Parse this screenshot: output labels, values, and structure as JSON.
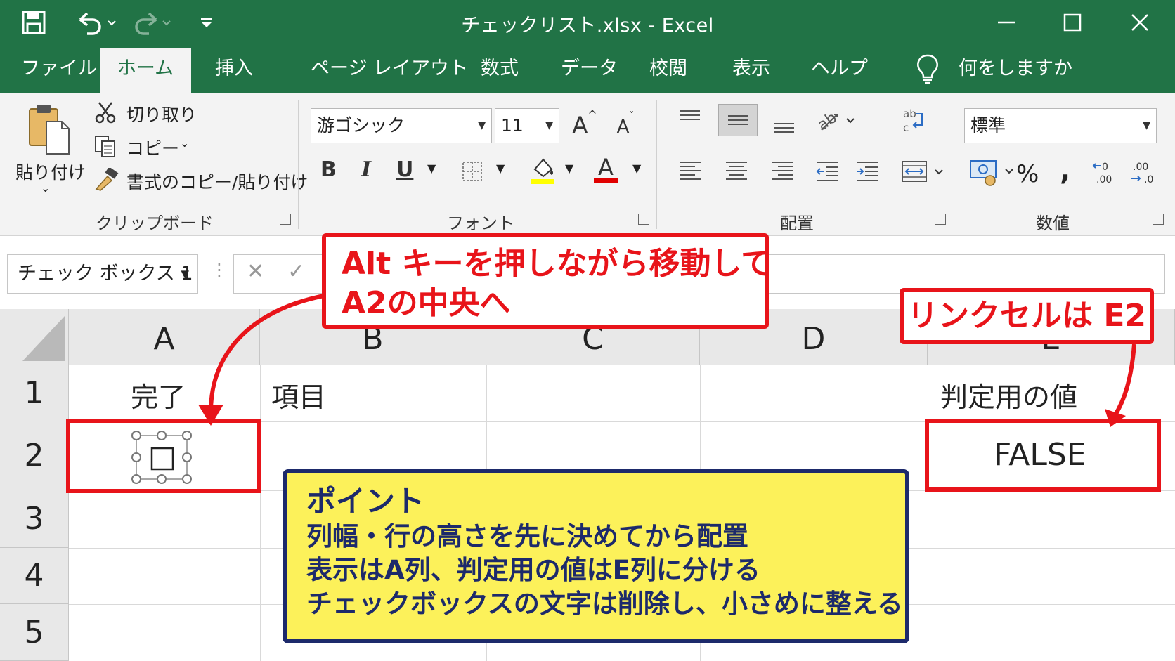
{
  "window": {
    "title": "チェックリスト.xlsx  -  Excel",
    "minimize_icon": "minimize-icon",
    "maximize_icon": "maximize-icon",
    "close_icon": "close-icon"
  },
  "tabs": [
    {
      "label": "ファイル",
      "active": false
    },
    {
      "label": "ホーム",
      "active": true
    },
    {
      "label": "挿入",
      "active": false
    },
    {
      "label": "ページ レイアウト",
      "active": false
    },
    {
      "label": "数式",
      "active": false
    },
    {
      "label": "データ",
      "active": false
    },
    {
      "label": "校閲",
      "active": false
    },
    {
      "label": "表示",
      "active": false
    },
    {
      "label": "ヘルプ",
      "active": false
    }
  ],
  "tell_me": "何をしますか",
  "ribbon": {
    "clipboard": {
      "paste_label": "貼り付け",
      "cut_label": "切り取り",
      "copy_label": "コピー",
      "format_painter_label": "書式のコピー/貼り付け",
      "group_label": "クリップボード"
    },
    "font": {
      "font_name": "游ゴシック",
      "font_size": "11",
      "bold": "B",
      "italic": "I",
      "underline": "U",
      "group_label": "フォント"
    },
    "alignment": {
      "group_label": "配置"
    },
    "number": {
      "format": "標準",
      "percent": "%",
      "comma": ",",
      "group_label": "数値"
    }
  },
  "formula_bar": {
    "name_box": "チェック ボックス 1",
    "cancel": "✕",
    "enter": "✓"
  },
  "grid": {
    "columns": [
      "A",
      "B",
      "C",
      "D",
      "E"
    ],
    "rows": [
      "1",
      "2",
      "3",
      "4",
      "5"
    ],
    "cells": {
      "A1": "完了",
      "B1": "項目",
      "E1": "判定用の値",
      "E2": "FALSE"
    }
  },
  "annotations": {
    "move_callout": [
      "Alt キーを押しながら移動して",
      "A2の中央へ"
    ],
    "link_callout": "リンクセルは E2",
    "point_box": {
      "title": "ポイント",
      "lines": [
        "列幅・行の高さを先に決めてから配置",
        "表示はA列、判定用の値はE列に分ける",
        "チェックボックスの文字は削除し、小さめに整える"
      ]
    },
    "highlight_color": "#e8141a",
    "point_bg_color": "#fcf15a",
    "point_border_color": "#1d2a6b"
  },
  "theme": {
    "excel_green": "#217346"
  }
}
